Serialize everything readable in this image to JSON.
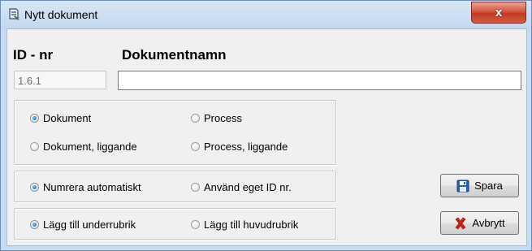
{
  "window": {
    "title": "Nytt dokument",
    "close_glyph": "x"
  },
  "header": {
    "id_label": "ID - nr",
    "name_label": "Dokumentnamn"
  },
  "fields": {
    "id_value": "1.6.1",
    "name_value": ""
  },
  "type_group": {
    "options": [
      {
        "label": "Dokument",
        "checked": true
      },
      {
        "label": "Process",
        "checked": false
      },
      {
        "label": "Dokument, liggande",
        "checked": false
      },
      {
        "label": "Process, liggande",
        "checked": false
      }
    ]
  },
  "numbering_group": {
    "options": [
      {
        "label": "Numrera automatiskt",
        "checked": true
      },
      {
        "label": "Använd eget ID nr.",
        "checked": false
      }
    ]
  },
  "heading_group": {
    "options": [
      {
        "label": "Lägg till underrubrik",
        "checked": true
      },
      {
        "label": "Lägg till huvudrubrik",
        "checked": false
      }
    ]
  },
  "buttons": {
    "save_label": "Spara",
    "save_icon": "floppy-disk-icon",
    "cancel_label": "Avbrytt",
    "cancel_icon": "red-x-icon"
  },
  "colors": {
    "titlebar": "#c3d8ef",
    "close": "#c23a24",
    "radio_on": "#0a5fb4",
    "dialog_bg": "#f0f0f0"
  }
}
